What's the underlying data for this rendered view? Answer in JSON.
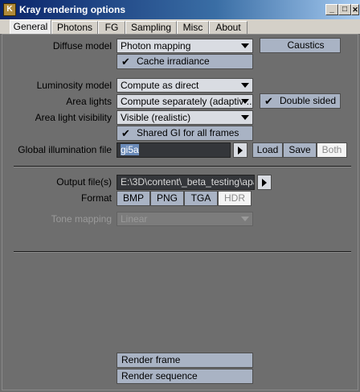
{
  "window": {
    "title": "Kray rendering options",
    "icon": "kray-app-icon",
    "controls": [
      "_",
      "□",
      "✕"
    ]
  },
  "tabs": [
    "General",
    "Photons",
    "FG",
    "Sampling",
    "Misc",
    "About"
  ],
  "active_tab": "General",
  "diffuse": {
    "label": "Diffuse model",
    "value": "Photon mapping",
    "caustics_label": "Caustics",
    "cache_label": "Cache irradiance",
    "cache_checked": true
  },
  "luminosity": {
    "label": "Luminosity model",
    "value": "Compute as direct"
  },
  "area_lights": {
    "label": "Area lights",
    "value": "Compute separately (adaptiv ...",
    "double_sided_label": "Double sided",
    "double_sided_checked": true
  },
  "area_visibility": {
    "label": "Area light visibility",
    "value": "Visible (realistic)"
  },
  "shared_gi": {
    "label": "Shared GI for all frames",
    "checked": true
  },
  "gi_file": {
    "label": "Global illumination file",
    "value": "gi5a",
    "load_label": "Load",
    "save_label": "Save",
    "both_label": "Both",
    "active_mode": "Both"
  },
  "output": {
    "label": "Output file(s)",
    "value": "E:\\3D\\content\\_beta_testing\\apa"
  },
  "format": {
    "label": "Format",
    "options": [
      "BMP",
      "PNG",
      "TGA",
      "HDR"
    ],
    "selected": "HDR"
  },
  "tone_mapping": {
    "label": "Tone mapping",
    "value": "Linear",
    "enabled": false
  },
  "render": {
    "frame_label": "Render frame",
    "sequence_label": "Render sequence"
  },
  "colors": {
    "panel": "#6e6e6e",
    "button": "#a9b3c4",
    "dropdown": "#d9dce2",
    "field": "#34363a",
    "titlebar": "#0a246a"
  }
}
